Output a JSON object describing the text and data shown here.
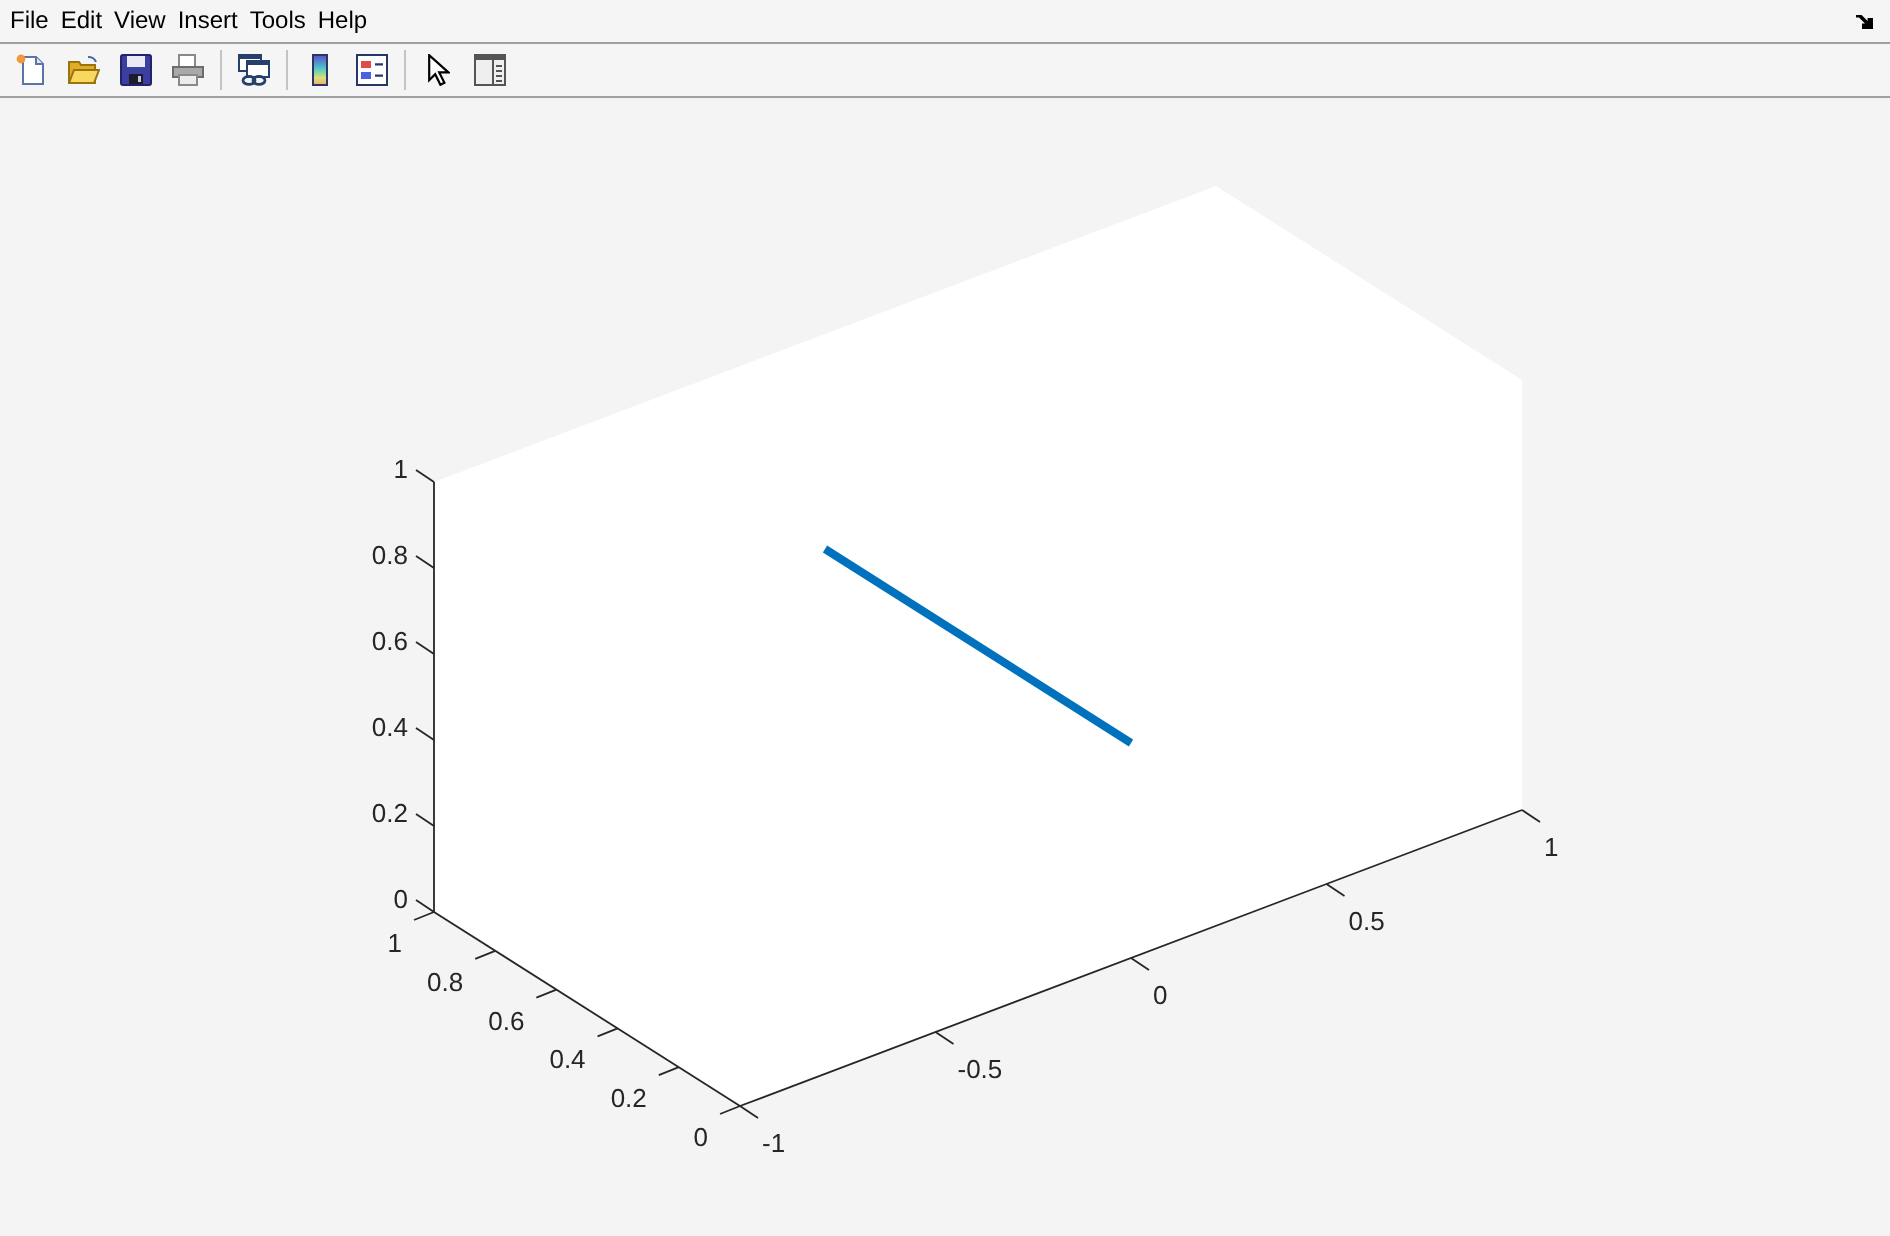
{
  "menu_bar": {
    "items": [
      "File",
      "Edit",
      "View",
      "Insert",
      "Tools",
      "Help"
    ]
  },
  "axes": {
    "z_ticks": [
      "1",
      "0.8",
      "0.6",
      "0.4",
      "0.2",
      "0"
    ],
    "y_ticks": [
      "1",
      "0.8",
      "0.6",
      "0.4",
      "0.2",
      "0"
    ],
    "x_ticks": [
      "-1",
      "-0.5",
      "0",
      "0.5",
      "1"
    ]
  }
}
